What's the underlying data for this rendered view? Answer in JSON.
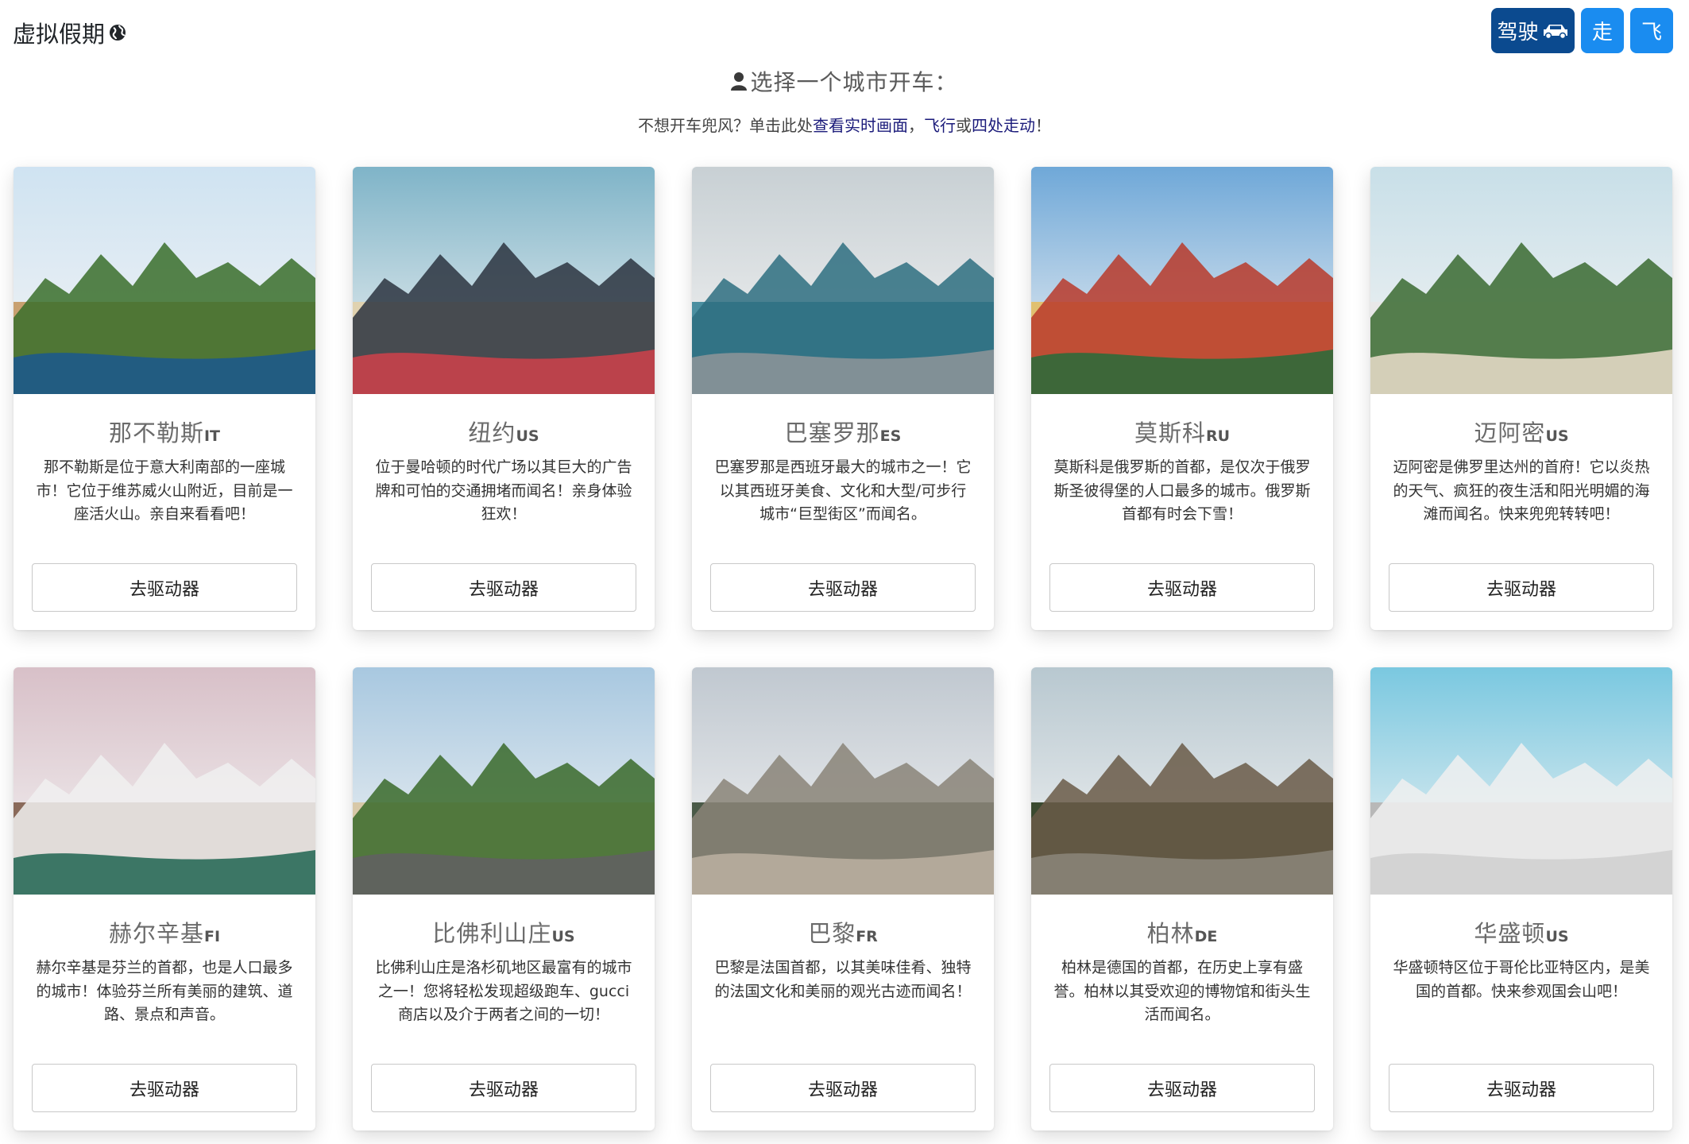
{
  "brand": {
    "title": "虚拟假期"
  },
  "nav": {
    "drive_label": "驾驶",
    "walk_label": "走",
    "fly_label": "飞"
  },
  "header": {
    "heading": "选择一个城市开车：",
    "sub_prefix": "不想开车兜风？单击此处",
    "link_live": "查看实时画面",
    "sep": "，",
    "link_fly": "飞行",
    "or": "或",
    "link_walk": "四处走动",
    "end": "！"
  },
  "cities": [
    {
      "name": "那不勒斯",
      "code": "IT",
      "desc": "那不勒斯是位于意大利南部的一座城市！它位于维苏威火山附近，目前是一座活火山。亲自来看看吧！",
      "button": "去驱动器",
      "palette": [
        "#cfe3f2",
        "#3a6e2a",
        "#1d5a8a",
        "#c8a070"
      ]
    },
    {
      "name": "纽约",
      "code": "US",
      "desc": "位于曼哈顿的时代广场以其巨大的广告牌和可怕的交通拥堵而闻名！亲身体验狂欢！",
      "button": "去驱动器",
      "palette": [
        "#7fb4c8",
        "#2b3440",
        "#c8414a",
        "#e0d2b0"
      ]
    },
    {
      "name": "巴塞罗那",
      "code": "ES",
      "desc": "巴塞罗那是西班牙最大的城市之一！它以其西班牙美食、文化和大型/可步行城市“巨型街区”而闻名。",
      "button": "去驱动器",
      "palette": [
        "#c8d0d4",
        "#2e6f80",
        "#8a9498",
        "#4a8ea0"
      ]
    },
    {
      "name": "莫斯科",
      "code": "RU",
      "desc": "莫斯科是俄罗斯的首都，是仅次于俄罗斯圣彼得堡的人口最多的城市。俄罗斯首都有时会下雪！",
      "button": "去驱动器",
      "palette": [
        "#6fa8d8",
        "#b83a2a",
        "#2f6a3a",
        "#e0c070"
      ]
    },
    {
      "name": "迈阿密",
      "code": "US",
      "desc": "迈阿密是佛罗里达州的首府！它以炎热的天气、疯狂的夜生活和阳光明媚的海滩而闻名。快来兜兜转转吧！",
      "button": "去驱动器",
      "palette": [
        "#c8dfe8",
        "#3a6a30",
        "#e2d8c4",
        "#e8e8e8"
      ]
    },
    {
      "name": "赫尔辛基",
      "code": "FI",
      "desc": "赫尔辛基是芬兰的首都，也是人口最多的城市！体验芬兰所有美丽的建筑、道路、景点和声音。",
      "button": "去驱动器",
      "palette": [
        "#d8c0c8",
        "#f0f0f0",
        "#2a6a58",
        "#8a6a5a"
      ]
    },
    {
      "name": "比佛利山庄",
      "code": "US",
      "desc": "比佛利山庄是洛杉矶地区最富有的城市之一！您将轻松发现超级跑车、gucci 商店以及介于两者之间的一切！",
      "button": "去驱动器",
      "palette": [
        "#a8c8e0",
        "#3a6a2a",
        "#606060",
        "#d8c8a8"
      ]
    },
    {
      "name": "巴黎",
      "code": "FR",
      "desc": "巴黎是法国首都，以其美味佳肴、独特的法国文化和美丽的观光古迹而闻名！",
      "button": "去驱动器",
      "palette": [
        "#c0c8d0",
        "#8a8478",
        "#b8ae9e",
        "#4a5a48"
      ]
    },
    {
      "name": "柏林",
      "code": "DE",
      "desc": "柏林是德国的首都，在历史上享有盛誉。柏林以其受欢迎的博物馆和街头生活而闻名。",
      "button": "去驱动器",
      "palette": [
        "#b8c8d0",
        "#6a5a48",
        "#8a8478",
        "#3a4a30"
      ]
    },
    {
      "name": "华盛顿",
      "code": "US",
      "desc": "华盛顿特区位于哥伦比亚特区内，是美国的首都。快来参观国会山吧！",
      "button": "去驱动器",
      "palette": [
        "#7ac8e0",
        "#f0f0f0",
        "#d0d0d0",
        "#b8b8b8"
      ]
    }
  ]
}
